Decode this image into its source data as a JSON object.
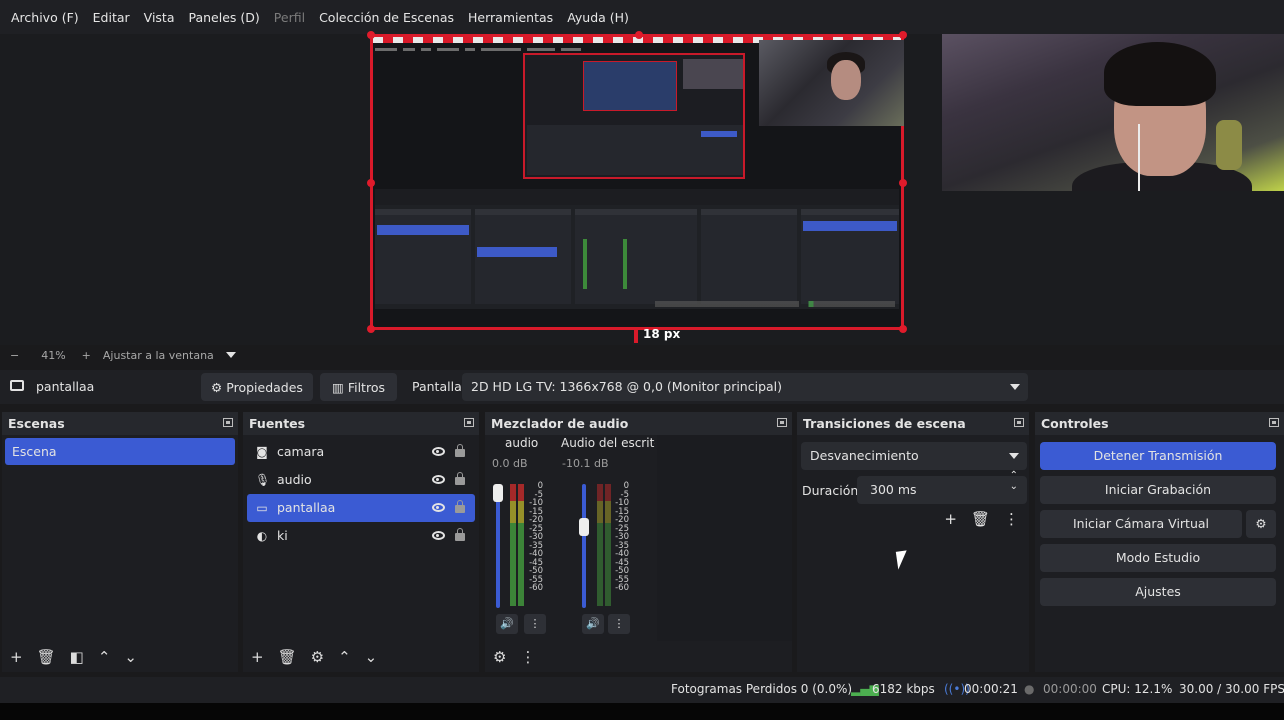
{
  "menu": [
    {
      "label": "Archivo (F)",
      "disabled": false
    },
    {
      "label": "Editar",
      "disabled": false
    },
    {
      "label": "Vista",
      "disabled": false
    },
    {
      "label": "Paneles (D)",
      "disabled": false
    },
    {
      "label": "Perfil",
      "disabled": true
    },
    {
      "label": "Colección de Escenas",
      "disabled": false
    },
    {
      "label": "Herramientas",
      "disabled": false
    },
    {
      "label": "Ayuda (H)",
      "disabled": false
    }
  ],
  "preview": {
    "size_label": "18 px",
    "zoom_minus": "−",
    "zoom_level": "41%",
    "zoom_plus": "+",
    "fit_label": "Ajustar a la ventana"
  },
  "source_toolbar": {
    "source_name": "pantallaa",
    "properties_label": "Propiedades",
    "filters_label": "Filtros",
    "display_label": "Pantalla",
    "display_value": "2D HD LG TV: 1366x768 @ 0,0 (Monitor principal)"
  },
  "scenes": {
    "title": "Escenas",
    "items": [
      "Escena"
    ],
    "selected": "Escena"
  },
  "sources": {
    "title": "Fuentes",
    "items": [
      {
        "name": "camara",
        "icon": "camera-icon",
        "glyph": "◙",
        "selected": false
      },
      {
        "name": "audio",
        "icon": "microphone-icon",
        "glyph": "🎙",
        "selected": false
      },
      {
        "name": "pantallaa",
        "icon": "monitor-icon",
        "glyph": "▭",
        "selected": true
      },
      {
        "name": "ki",
        "icon": "browser-icon",
        "glyph": "◐",
        "selected": false
      }
    ]
  },
  "mixer": {
    "title": "Mezclador de audio",
    "channels": [
      {
        "name": "audio",
        "db": "0.0 dB",
        "fader_level": 1.0
      },
      {
        "name": "Audio del escritorio",
        "db": "-10.1 dB",
        "fader_level": 0.68
      }
    ],
    "scale": [
      "0",
      "-5",
      "-10",
      "-15",
      "-20",
      "-25",
      "-30",
      "-35",
      "-40",
      "-45",
      "-50",
      "-55",
      "-60"
    ]
  },
  "transitions": {
    "title": "Transiciones de escena",
    "selected": "Desvanecimiento",
    "duration_label": "Duración",
    "duration_value": "300 ms"
  },
  "controls": {
    "title": "Controles",
    "stop_stream": "Detener Transmisión",
    "start_recording": "Iniciar Grabación",
    "virtual_camera": "Iniciar Cámara Virtual",
    "studio_mode": "Modo Estudio",
    "settings": "Ajustes"
  },
  "status": {
    "dropped_frames": "Fotogramas Perdidos 0 (0.0%)",
    "bitrate": "6182 kbps",
    "stream_time": "00:00:21",
    "record_time": "00:00:00",
    "cpu": "CPU: 12.1%",
    "fps": "30.00 / 30.00 FPS"
  },
  "colors": {
    "accent": "#3b5bd3",
    "selection_border": "#d91a2a",
    "meter_green": "#3f8f3a"
  }
}
